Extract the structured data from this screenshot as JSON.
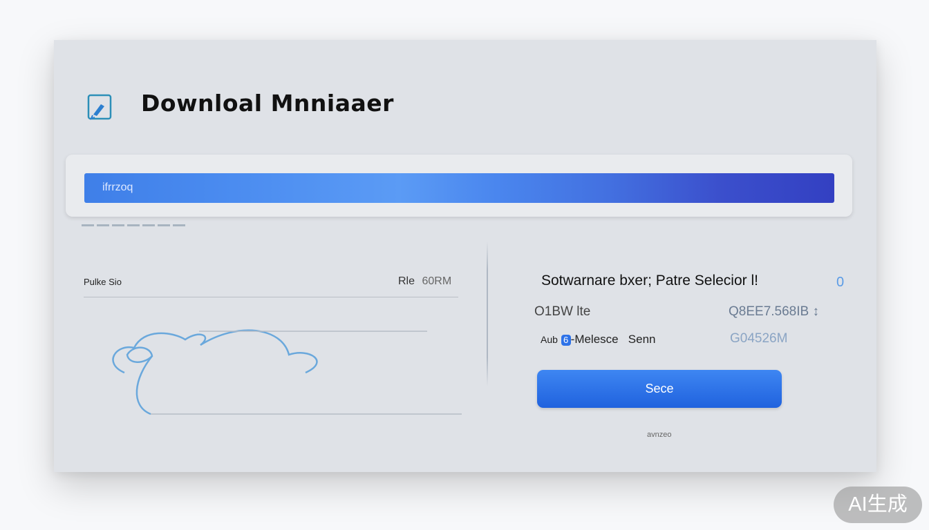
{
  "window": {
    "title": "Downloal Mnniaaer"
  },
  "progress": {
    "label": "ifrrzoq",
    "fraction": 1.0
  },
  "left_panel": {
    "label": "Pulke Sio",
    "file_label": "Rle",
    "file_size": "60RM"
  },
  "right_panel": {
    "title": "Sotwarnare bxer; Patre Selecior l!",
    "indicator": "0",
    "rows": [
      {
        "label": "O1BW lte",
        "value": "Q8EE7.568IB ↕"
      },
      {
        "label_prefix": "Aub",
        "badge": "6",
        "label_suffix": "-Melesce   Senn",
        "value": "G04526M"
      }
    ],
    "button_label": "Sece",
    "footnote": "avnzeo"
  },
  "watermark": "AI生成",
  "colors": {
    "accent": "#2d72e8",
    "progress_start": "#3f7fe8",
    "progress_end": "#3340c2",
    "window_bg": "#dfe2e7"
  },
  "icons": {
    "app": "download-pencil-icon",
    "illustration": "cloud-illustration"
  }
}
